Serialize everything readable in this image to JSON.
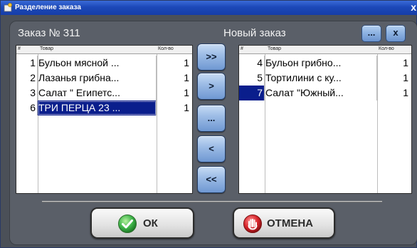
{
  "window": {
    "title": "Разделение заказа",
    "close_label": "x"
  },
  "left": {
    "title": "Заказ № 311",
    "columns": {
      "num": "#",
      "name": "Товар",
      "qty": "Кол-во"
    },
    "rows": [
      {
        "num": "1",
        "name": "Бульон мясной ...",
        "qty": "1"
      },
      {
        "num": "2",
        "name": "Лазанья грибна...",
        "qty": "1"
      },
      {
        "num": "3",
        "name": "Салат \" Египетс...",
        "qty": "1"
      },
      {
        "num": "6",
        "name": "ТРИ  ПЕРЦА 23 ...",
        "qty": "1"
      }
    ]
  },
  "right": {
    "title": "Новый заказ",
    "columns": {
      "num": "#",
      "name": "Товар",
      "qty": "Кол-во"
    },
    "rows": [
      {
        "num": "4",
        "name": "Бульон  грибно...",
        "qty": "1"
      },
      {
        "num": "5",
        "name": "Тортилини с ку...",
        "qty": "1"
      },
      {
        "num": "7",
        "name": "Салат  \"Южный...",
        "qty": "1"
      }
    ],
    "more_label": "...",
    "close_label": "x"
  },
  "transfer": {
    "all_right": ">>",
    "one_right": ">",
    "more": "...",
    "one_left": "<",
    "all_left": "<<"
  },
  "footer": {
    "ok_label": "ОК",
    "cancel_label": "ОТМЕНА"
  },
  "colors": {
    "titlebar": "#1c48b8",
    "selection": "#0a1e8c",
    "ok_icon": "#3fb54a",
    "cancel_icon": "#d9262c"
  }
}
